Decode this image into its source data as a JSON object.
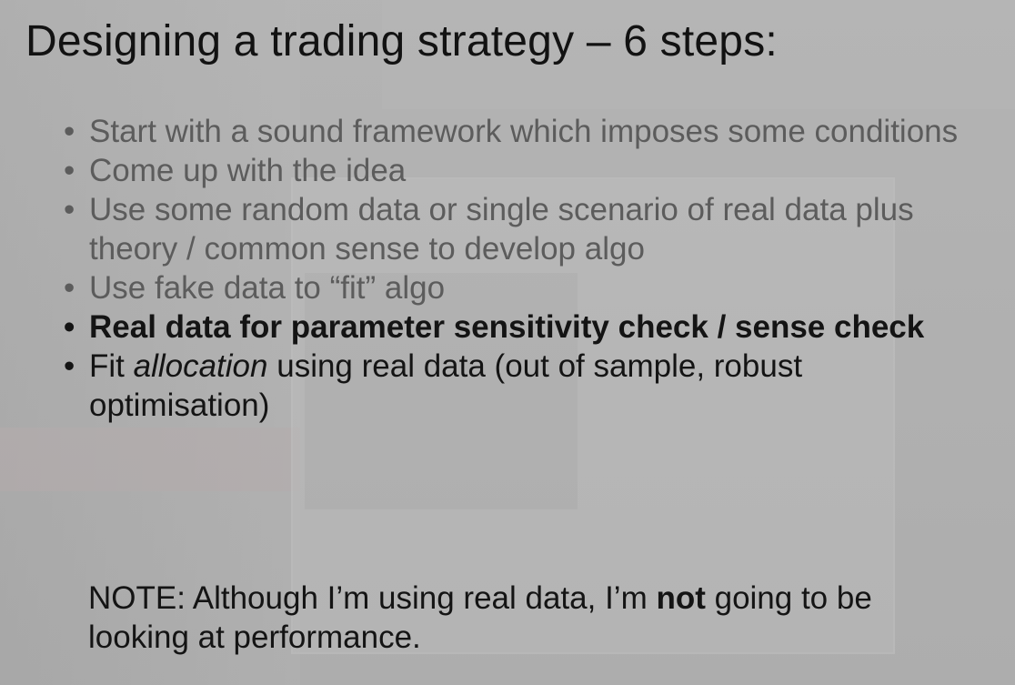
{
  "slide": {
    "title": "Designing a trading strategy – 6 steps:",
    "bullet_char": "•",
    "bullets": [
      {
        "text": "Start with a sound framework which imposes some conditions"
      },
      {
        "text": "Come up with the idea"
      },
      {
        "text": "Use some random data or single scenario of real data plus theory / common sense to develop algo"
      },
      {
        "text": "Use fake data to “fit” algo"
      },
      {
        "text": "Real data for parameter sensitivity check / sense check"
      },
      {
        "prefix": "Fit ",
        "emphasis": "allocation",
        "suffix": " using real data (out of sample, robust optimisation)"
      }
    ],
    "note": {
      "before": "NOTE: Although I’m using real data, I’m ",
      "bold": "not",
      "after": " going to be looking at performance."
    }
  }
}
